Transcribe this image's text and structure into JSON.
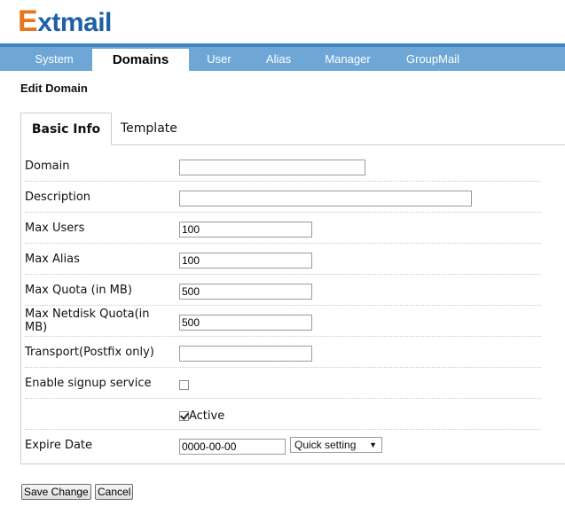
{
  "logo": {
    "first": "E",
    "rest": "xtmail"
  },
  "nav": [
    "System",
    "Domains",
    "User",
    "Alias",
    "Manager",
    "GroupMail"
  ],
  "page_title": "Edit Domain",
  "tabs": [
    "Basic Info",
    "Template"
  ],
  "form": {
    "domain_label": "Domain",
    "domain_value": "",
    "description_label": "Description",
    "description_value": "",
    "max_users_label": "Max Users",
    "max_users_value": "100",
    "max_alias_label": "Max Alias",
    "max_alias_value": "100",
    "max_quota_label": "Max Quota (in MB)",
    "max_quota_value": "500",
    "max_netdisk_label": "Max Netdisk Quota(in MB)",
    "max_netdisk_value": "500",
    "transport_label": "Transport(Postfix only)",
    "transport_value": "",
    "signup_label": "Enable signup service",
    "signup_checked": false,
    "active_label": "Active",
    "active_checked": true,
    "expire_label": "Expire Date",
    "expire_value": "0000-00-00",
    "quick_setting": "Quick setting"
  },
  "buttons": {
    "save": "Save Change",
    "cancel": "Cancel"
  },
  "colors": {
    "accent": "#3e86c4",
    "nav_bg": "#6ea7d6",
    "logo_orange": "#e8761e",
    "logo_blue": "#1e5fa7"
  }
}
